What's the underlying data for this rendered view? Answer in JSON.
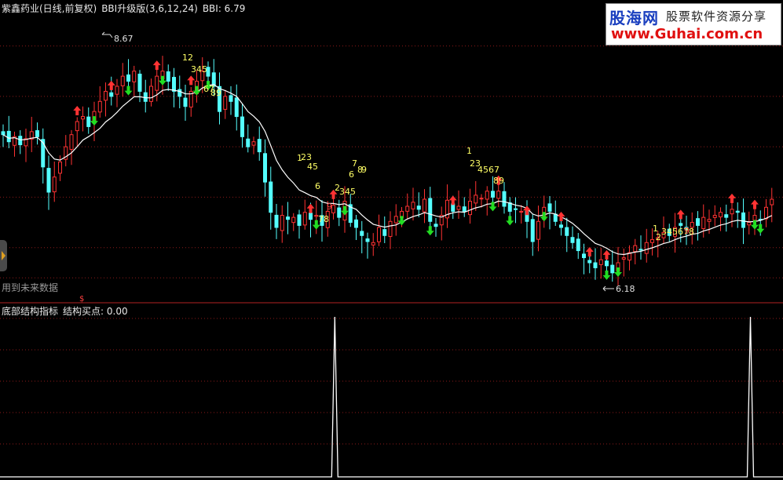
{
  "header": {
    "title": "紫鑫药业(日线,前复权)",
    "indicator": "BBI升级版(3,6,12,24)",
    "value_label": "BBI: 6.79"
  },
  "subpanel": {
    "title": "底部结构指标",
    "value_label": "结构买点: 0.00"
  },
  "watermark": {
    "brand": "股海网",
    "slogan": "股票软件资源分享",
    "url": "www.Guhai.com.cn"
  },
  "future_note": "用到未来数据",
  "colors": {
    "up": "#ff3232",
    "down": "#54ffff",
    "bbi": "#ffffff",
    "grid": "#8b1a1a",
    "count_yellow": "#ffff66",
    "count_red": "#ff4444",
    "buy_arrow": "#ff3333",
    "sell_arrow": "#22dd22"
  },
  "icons": {
    "buy": "up-arrow-icon",
    "sell": "down-arrow-icon",
    "dollar": "dollar-sign-icon"
  },
  "chart_data": [
    {
      "type": "candlestick",
      "ylim": [
        6.0,
        8.8
      ],
      "annotations": [
        {
          "label": "8.67",
          "kind": "high"
        },
        {
          "label": "6.18",
          "kind": "low"
        }
      ],
      "close": [
        7.62,
        7.55,
        7.6,
        7.52,
        7.58,
        7.65,
        7.6,
        7.3,
        7.05,
        7.2,
        7.35,
        7.5,
        7.62,
        7.75,
        7.8,
        7.7,
        7.85,
        7.95,
        8.05,
        8.0,
        8.1,
        8.2,
        8.15,
        8.25,
        8.05,
        7.95,
        8.1,
        8.2,
        8.25,
        8.15,
        8.05,
        8.0,
        7.9,
        8.05,
        8.15,
        8.25,
        8.2,
        8.1,
        7.85,
        8.0,
        7.95,
        7.8,
        7.6,
        7.5,
        7.55,
        7.45,
        7.15,
        6.85,
        6.7,
        6.82,
        6.78,
        6.8,
        6.72,
        6.85,
        6.78,
        6.82,
        6.72,
        6.86,
        6.92,
        6.8,
        6.96,
        6.75,
        6.7,
        6.62,
        6.56,
        6.55,
        6.7,
        6.62,
        6.76,
        6.81,
        6.86,
        6.91,
        6.95,
        6.88,
        6.98,
        6.76,
        6.71,
        6.82,
        6.97,
        6.86,
        6.91,
        6.86,
        6.96,
        7.02,
        6.99,
        7.06,
        7.0,
        7.06,
        6.91,
        6.86,
        6.88,
        6.86,
        6.76,
        6.56,
        6.76,
        6.9,
        6.86,
        6.76,
        6.7,
        6.62,
        6.55,
        6.47,
        6.4,
        6.35,
        6.3,
        6.38,
        6.32,
        6.25,
        6.35,
        6.4,
        6.45,
        6.52,
        6.48,
        6.55,
        6.58,
        6.6,
        6.65,
        6.62,
        6.7,
        6.72,
        6.68,
        6.75,
        6.72,
        6.8,
        6.78,
        6.82,
        6.85,
        6.8,
        6.88,
        6.85,
        6.7,
        6.75,
        6.82,
        6.78,
        6.9,
        6.98
      ],
      "buy_signals_bar": [
        13,
        19,
        27,
        33,
        54,
        58,
        79,
        87,
        92,
        98,
        103,
        106,
        119,
        128,
        132
      ],
      "sell_signals_bar": [
        16,
        22,
        28,
        34,
        36,
        55,
        60,
        70,
        75,
        86,
        89,
        95,
        106,
        108,
        132,
        133
      ],
      "count_sequences": [
        {
          "digits": "12",
          "color": "yellow"
        },
        {
          "digits": "345",
          "color": "yellow"
        },
        {
          "digits": "67",
          "color": "yellow"
        },
        {
          "digits": "89",
          "color": "yellow"
        },
        {
          "digits": "1",
          "color": "yellow"
        },
        {
          "digits": "23",
          "color": "yellow"
        },
        {
          "digits": "45",
          "color": "yellow"
        },
        {
          "digits": "6",
          "color": "yellow"
        },
        {
          "digits": "7",
          "color": "yellow"
        },
        {
          "digits": "8",
          "color": "yellow"
        },
        {
          "digits": "9",
          "color": "yellow"
        },
        {
          "digits": "2",
          "color": "yellow"
        },
        {
          "digits": "345",
          "color": "yellow"
        },
        {
          "digits": "6",
          "color": "yellow"
        },
        {
          "digits": "78",
          "color": "yellow"
        },
        {
          "digits": "9",
          "color": "red"
        },
        {
          "digits": "1",
          "color": "yellow"
        },
        {
          "digits": "23",
          "color": "yellow"
        },
        {
          "digits": "4567",
          "color": "yellow"
        },
        {
          "digits": "89",
          "color": "yellow"
        },
        {
          "digits": "1",
          "color": "yellow"
        },
        {
          "digits": "2",
          "color": "yellow"
        },
        {
          "digits": "345678",
          "color": "yellow"
        },
        {
          "digits": "9",
          "color": "red"
        }
      ]
    },
    {
      "type": "line",
      "series_label": "结构买点",
      "spikes_bar": [
        61,
        134
      ],
      "ylim": [
        0,
        1
      ]
    }
  ]
}
